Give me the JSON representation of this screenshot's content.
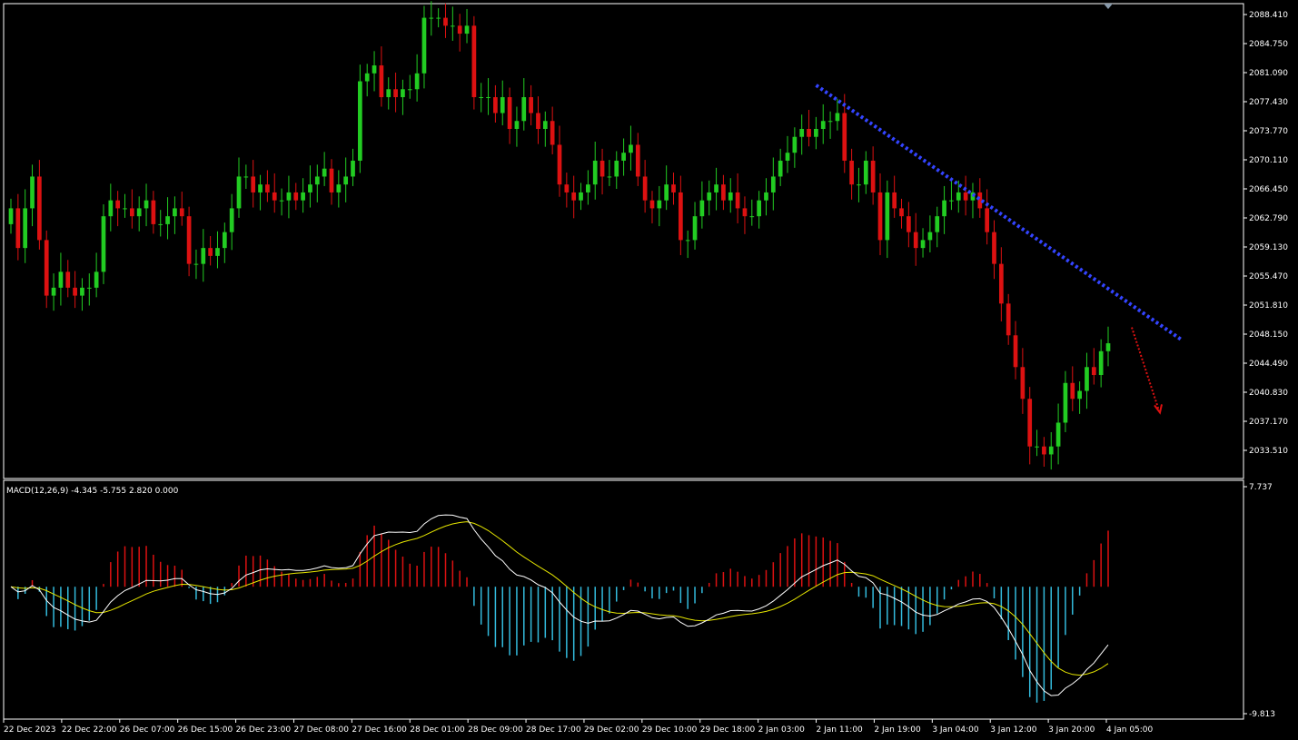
{
  "colors": {
    "background": "#000000",
    "frame": "#ffffff",
    "bull_candle": "#22cc22",
    "bear_candle": "#dd1111",
    "trendline": "#3344ff",
    "forecast_arrow": "#dd1111",
    "macd_line": "#ffffff",
    "signal_line": "#e6e600",
    "hist_positive": "#dd1111",
    "hist_negative": "#33bbdd"
  },
  "icons": {
    "scroll_marker": "triangle-down-icon"
  },
  "chart_data": [
    {
      "type": "candlestick",
      "ylim": [
        2030.0,
        2090.0
      ],
      "y_ticks": [
        "2088.410",
        "2084.750",
        "2081.090",
        "2077.430",
        "2073.770",
        "2070.110",
        "2066.450",
        "2062.790",
        "2059.130",
        "2055.470",
        "2051.810",
        "2048.150",
        "2044.490",
        "2040.830",
        "2037.170",
        "2033.510"
      ],
      "x_tick_labels": [
        "22 Dec 2023",
        "22 Dec 22:00",
        "26 Dec 07:00",
        "26 Dec 15:00",
        "26 Dec 23:00",
        "27 Dec 08:00",
        "27 Dec 16:00",
        "28 Dec 01:00",
        "28 Dec 09:00",
        "28 Dec 17:00",
        "29 Dec 02:00",
        "29 Dec 10:00",
        "29 Dec 18:00",
        "2 Jan 03:00",
        "2 Jan 11:00",
        "2 Jan 19:00",
        "3 Jan 04:00",
        "3 Jan 12:00",
        "3 Jan 20:00",
        "4 Jan 05:00"
      ],
      "closes": [
        2064,
        2059,
        2064,
        2068,
        2060,
        2053,
        2054,
        2056,
        2054,
        2053,
        2054,
        2054,
        2056,
        2063,
        2065,
        2064,
        2064,
        2063,
        2064,
        2065,
        2062,
        2062,
        2063,
        2064,
        2063,
        2057,
        2057,
        2059,
        2058,
        2059,
        2061,
        2064,
        2068,
        2068,
        2066,
        2067,
        2066,
        2065,
        2065,
        2066,
        2065,
        2066,
        2067,
        2068,
        2069,
        2066,
        2067,
        2068,
        2070,
        2080,
        2081,
        2082,
        2078,
        2079,
        2078,
        2079,
        2079,
        2081,
        2088,
        2088,
        2088,
        2087,
        2087,
        2086,
        2087,
        2078,
        2078,
        2078,
        2076,
        2078,
        2074,
        2075,
        2078,
        2076,
        2074,
        2075,
        2072,
        2067,
        2066,
        2065,
        2066,
        2067,
        2070,
        2068,
        2068,
        2070,
        2071,
        2072,
        2068,
        2065,
        2064,
        2065,
        2067,
        2066,
        2060,
        2060,
        2063,
        2065,
        2066,
        2067,
        2065,
        2066,
        2064,
        2063,
        2063,
        2065,
        2066,
        2068,
        2070,
        2071,
        2073,
        2074,
        2073,
        2074,
        2075,
        2075,
        2076,
        2070,
        2067,
        2067,
        2070,
        2066,
        2060,
        2066,
        2064,
        2063,
        2061,
        2059,
        2060,
        2061,
        2063,
        2065,
        2065,
        2066,
        2065,
        2066,
        2064,
        2061,
        2057,
        2052,
        2048,
        2044,
        2040,
        2034,
        2034,
        2033,
        2034,
        2037,
        2042,
        2040,
        2041,
        2044,
        2043,
        2046,
        2047
      ],
      "trendline": {
        "x_labels": [
          "2 Jan 11:00",
          "4 Jan 05:00"
        ],
        "from_value": 2079.5,
        "to_value": 2047.5
      },
      "forecast_arrow": {
        "from_value": 2049.0,
        "to_value": 2038.5
      }
    },
    {
      "type": "macd",
      "legend": "MACD(12,26,9) -4.345 -5.755 2.820 0.000",
      "y_ticks": [
        "7.737",
        "-9.813"
      ],
      "ylim": [
        -9.813,
        7.737
      ]
    }
  ]
}
